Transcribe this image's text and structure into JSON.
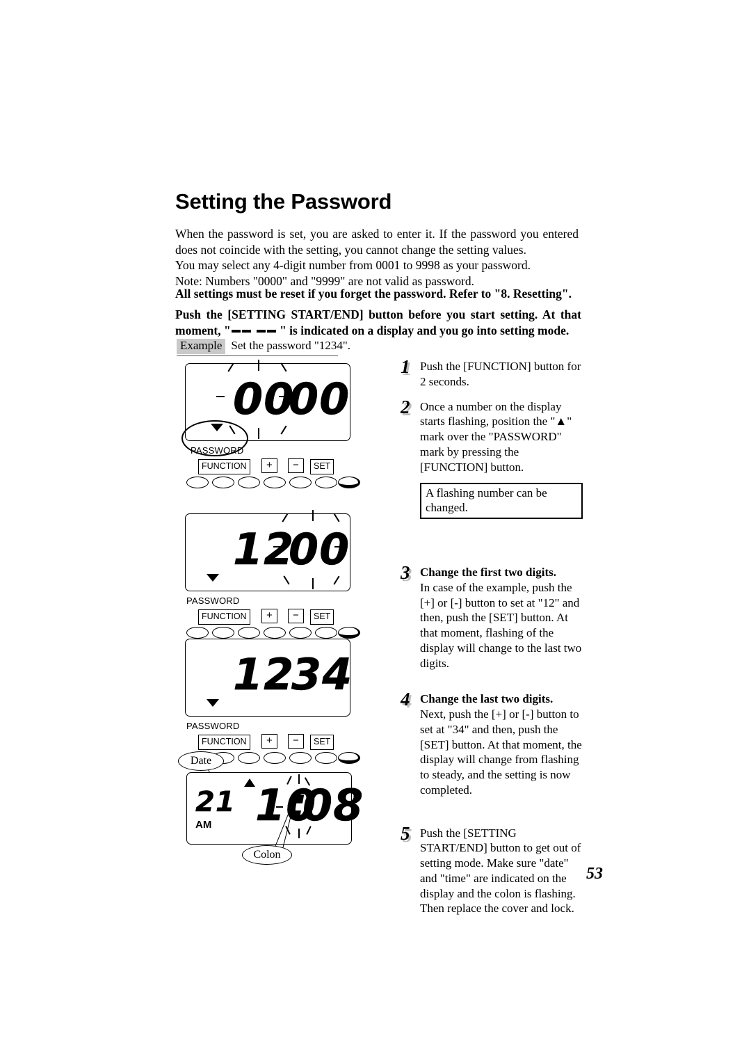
{
  "document": {
    "title": "Setting the Password",
    "page_number": "53"
  },
  "intro": {
    "paragraph_1": "When the password is set, you are asked to enter it.  If the password you entered does not coincide with the setting, you cannot change the setting values.",
    "paragraph_2": "You may select any 4-digit number from 0001 to 9998 as your password.",
    "paragraph_3": "Note: Numbers \"0000\" and \"9999\" are not valid as password."
  },
  "warnings": {
    "reset_notice": "All settings must be reset if you forget the password.  Refer to \"8. Resetting\".",
    "setting_mode_prefix": "Push the [SETTING START/END] button before you start setting. At that moment,",
    "setting_mode_quote_open": "\"",
    "setting_mode_quote_close": " \"",
    "setting_mode_suffix": " is indicated on a display and you go into setting mode."
  },
  "example": {
    "tag": "Example",
    "text": "Set the password \"1234\"."
  },
  "panels": [
    {
      "id": "panel-1",
      "display_value": "00 00",
      "digits_left": "00",
      "digits_right": "00",
      "marker_label": "PASSWORD",
      "marker_shape": "triangle-down",
      "highlighted": true,
      "flashing": "first-two-digits"
    },
    {
      "id": "panel-2",
      "display_value": "12 00",
      "digits_left": "12",
      "digits_right": "00",
      "marker_label": "PASSWORD",
      "marker_shape": "triangle-down",
      "highlighted": false,
      "flashing": "last-two-digits"
    },
    {
      "id": "panel-3",
      "display_value": "12 34",
      "digits_left": "12",
      "digits_right": "34",
      "marker_label": "PASSWORD",
      "marker_shape": "triangle-down",
      "highlighted": false,
      "flashing": "none"
    }
  ],
  "clock_panel": {
    "id": "panel-4",
    "date_value": "21",
    "meridiem": "AM",
    "time_hours": "10",
    "time_separator": ":",
    "time_minutes": "08",
    "marker_shape": "triangle-up",
    "callout_date": "Date",
    "callout_colon": "Colon",
    "flashing": "colon"
  },
  "controls": {
    "function_label": "FUNCTION",
    "plus_label": "+",
    "minus_label": "−",
    "set_label": "SET",
    "button_count": 7
  },
  "steps": [
    {
      "number": "1",
      "heading": "",
      "body": "Push the [FUNCTION] button for 2 seconds."
    },
    {
      "number": "2",
      "heading": "",
      "body": "Once a number on the display starts flashing, position the \"▲\" mark over the \"PASSWORD\" mark by pressing the [FUNCTION] button."
    },
    {
      "number": "3",
      "heading": "Change the first two digits.",
      "body": "In case of the example, push the [+] or [-] button to set at \"12\" and then, push the [SET] button. At that moment, flashing of the display will change to the last two digits."
    },
    {
      "number": "4",
      "heading": "Change the last two digits.",
      "body": "Next, push the [+] or [-] button to set at \"34\" and then, push the [SET] button. At that moment, the display will change from flashing to steady, and the setting is now completed."
    },
    {
      "number": "5",
      "heading": "",
      "body": "Push the [SETTING START/END] button to get out of setting mode. Make sure \"date\" and \"time\" are indicated on the display and the colon is flashing.  Then replace the cover and lock."
    }
  ],
  "note_box": {
    "text": "A flashing number can be changed."
  },
  "colors": {
    "ink": "#000000",
    "example_tag_bg": "#c9c9c9",
    "step_number_shadow": "#bdbdbd",
    "paper": "#ffffff"
  }
}
